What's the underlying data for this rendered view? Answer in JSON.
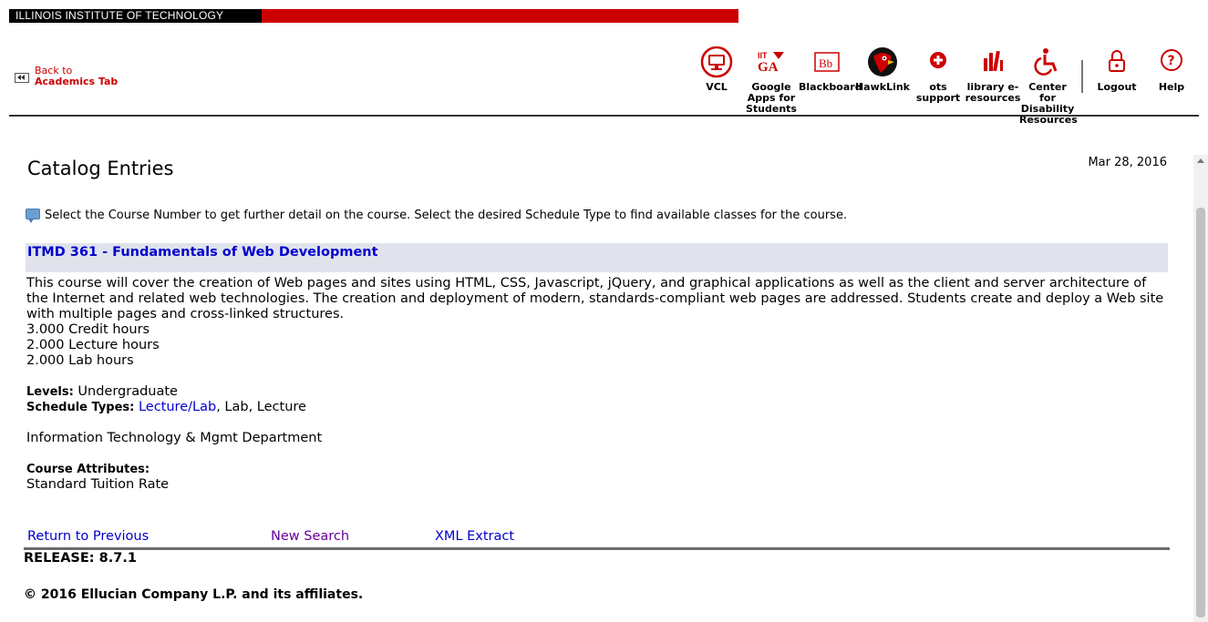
{
  "header": {
    "institution": "ILLINOIS INSTITUTE OF TECHNOLOGY",
    "back_link": {
      "line1": "Back to",
      "line2": "Academics Tab"
    },
    "nav": [
      {
        "label": "VCL",
        "icon": "monitor-icon"
      },
      {
        "label": "Google Apps for Students",
        "icon": "google-apps-icon",
        "badge": "IIT GA"
      },
      {
        "label": "Blackboard",
        "icon": "blackboard-icon",
        "badge": "Bb"
      },
      {
        "label": "HawkLink",
        "icon": "hawk-icon"
      },
      {
        "label": "ots support",
        "icon": "plus-icon"
      },
      {
        "label": "library e-resources",
        "icon": "books-icon"
      },
      {
        "label": "Center for Disability Resources",
        "icon": "wheelchair-icon"
      },
      {
        "label": "Logout",
        "icon": "lock-icon"
      },
      {
        "label": "Help",
        "icon": "question-icon"
      }
    ],
    "accent": "#cc0000"
  },
  "page": {
    "title": "Catalog Entries",
    "date": "Mar 28, 2016",
    "info": "Select the Course Number to get further detail on the course. Select the desired Schedule Type to find available classes for the course."
  },
  "course": {
    "title": "ITMD 361 - Fundamentals of Web Development",
    "description": "This course will cover the creation of Web pages and sites using HTML, CSS, Javascript, jQuery, and graphical applications as well as the client and server architecture of the Internet and related web technologies. The creation and deployment of modern, standards-compliant web pages are addressed. Students create and deploy a Web site with multiple pages and cross-linked structures.",
    "credit_hours": "3.000 Credit hours",
    "lecture_hours": "2.000 Lecture hours",
    "lab_hours": "2.000 Lab hours",
    "levels_label": "Levels:",
    "levels": "Undergraduate",
    "schedule_types_label": "Schedule Types:",
    "schedule_type_link": "Lecture/Lab",
    "schedule_types_rest": ", Lab, Lecture",
    "department": "Information Technology & Mgmt Department",
    "attributes_label": "Course Attributes:",
    "attributes": "Standard Tuition Rate"
  },
  "footer": {
    "links": [
      "Return to Previous",
      "New Search",
      "XML Extract"
    ],
    "release": "RELEASE: 8.7.1",
    "copyright": "© 2016 Ellucian Company L.P. and its affiliates."
  }
}
